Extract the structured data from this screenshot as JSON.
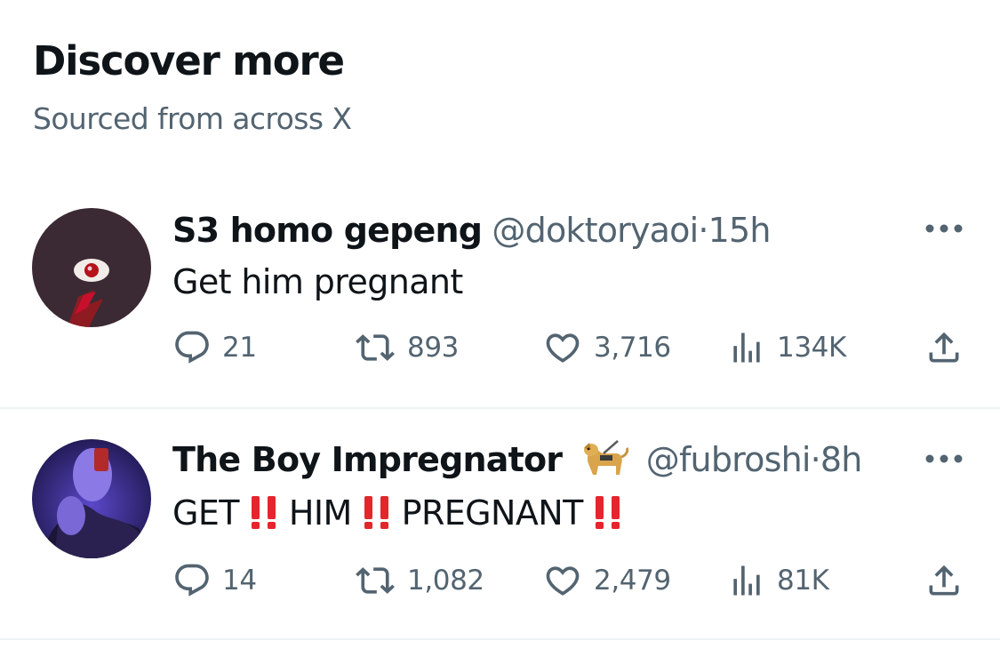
{
  "header": {
    "title": "Discover more",
    "subtitle": "Sourced from across X"
  },
  "tweets": [
    {
      "display_name": "S3 homo gepeng",
      "badge_emoji": "",
      "handle": "@doktoryaoi",
      "separator": "·",
      "time": "15h",
      "text_parts": [
        "Get him pregnant"
      ],
      "replies": "21",
      "reposts": "893",
      "likes": "3,716",
      "views": "134K",
      "avatar_colors": [
        "#3b2a33",
        "#c8102e"
      ]
    },
    {
      "display_name": "The Boy Impregnator",
      "badge_emoji": "guide-dog-emoji",
      "handle": "@fubroshi",
      "separator": "·",
      "time": "8h",
      "text_parts": [
        "GET",
        "HIM",
        "PREGNANT"
      ],
      "emphasis_emoji": "double-exclamation-mark-emoji",
      "replies": "14",
      "reposts": "1,082",
      "likes": "2,479",
      "views": "81K",
      "avatar_colors": [
        "#1a1446",
        "#6c55e0"
      ]
    }
  ],
  "colors": {
    "primary_text": "#0f1419",
    "secondary_text": "#536471",
    "divider": "#eff3f4",
    "emphasis_red": "#e4262c"
  }
}
